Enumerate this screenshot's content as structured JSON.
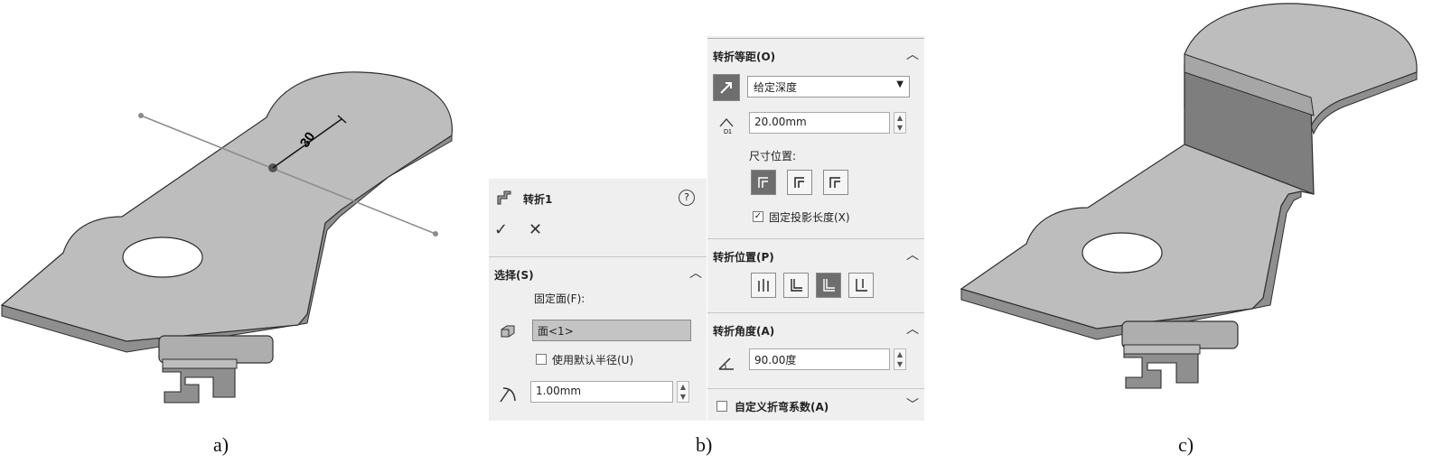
{
  "figures": {
    "a": {
      "caption": "a)",
      "dimension_label": "30"
    },
    "b": {
      "caption": "b)"
    },
    "c": {
      "caption": "c)"
    }
  },
  "feature_panel": {
    "title": "转折1",
    "help": "?",
    "ok": "✓",
    "cancel": "✕",
    "selection": {
      "title": "选择(S)",
      "fixed_face_label": "固定面(F):",
      "fixed_face_value": "面<1>",
      "use_default_radius": "使用默认半径(U)",
      "radius_value": "1.00mm"
    },
    "offset": {
      "title": "转折等距(O)",
      "end_condition": "给定深度",
      "distance_value": "20.00mm",
      "dimension_position_label": "尺寸位置:",
      "fix_projected_length": "固定投影长度(X)",
      "fix_projected_length_checked": true
    },
    "position": {
      "title": "转折位置(P)"
    },
    "angle": {
      "title": "转折角度(A)",
      "value": "90.00度"
    },
    "custom_bend": {
      "title": "自定义折弯系数(A)"
    }
  },
  "colors": {
    "panel_bg": "#efefef",
    "part_top": "#bdbdbd",
    "part_side": "#8f8f8f",
    "part_edge": "#2e2e2e"
  },
  "icons": {
    "jog": "jog-feature-icon",
    "help": "help-icon",
    "ok": "check-icon",
    "cancel": "close-icon",
    "collapse": "chevron-up-icon",
    "expand": "chevron-down-icon"
  }
}
